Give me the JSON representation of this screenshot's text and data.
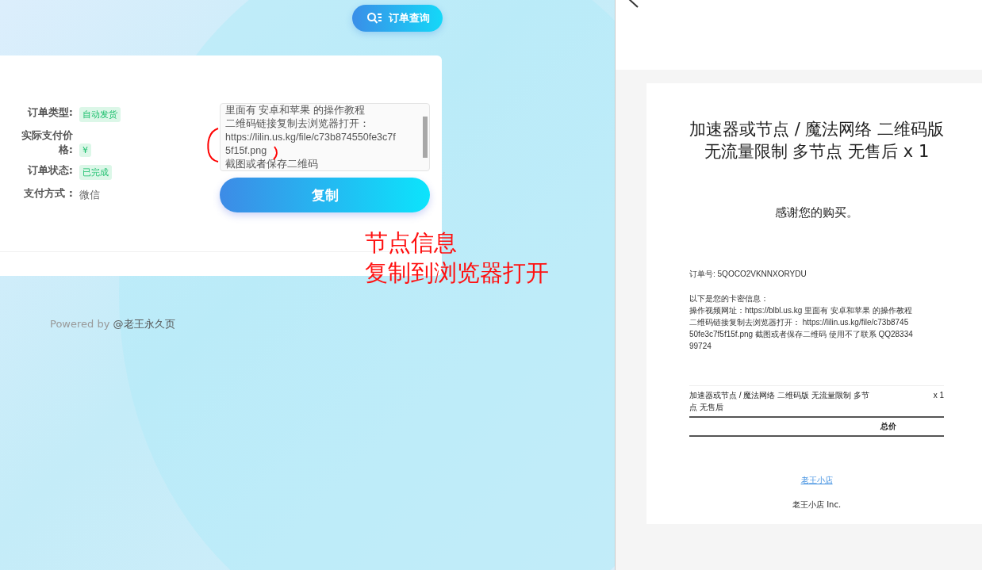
{
  "query_button": {
    "label": "订单查询"
  },
  "order": {
    "fields": [
      {
        "label": "订单类型:",
        "value": "自动发货",
        "kind": "tag"
      },
      {
        "label": "实际支付价格:",
        "value": "¥",
        "kind": "tag"
      },
      {
        "label": "订单状态:",
        "value": "已完成",
        "kind": "tag"
      },
      {
        "label": "支付方式 :",
        "value": "微信",
        "kind": "plain"
      }
    ],
    "card_text": [
      "里面有 安卓和苹果 的操作教程",
      "二维码链接复制去浏览器打开：",
      "https://lilin.us.kg/file/c73b874550fe3c7f",
      "5f15f.png",
      "截图或者保存二维码"
    ],
    "copy_button": "复制"
  },
  "annotation": [
    "节点信息",
    "复制到浏览器打开"
  ],
  "footer": {
    "prefix": "Powered by",
    "name": "@老王永久页"
  },
  "receipt": {
    "title": [
      "加速器或节点 / 魔法网络 二维码版",
      "无流量限制 多节点 无售后 x 1"
    ],
    "thanks": "感谢您的购买。",
    "order_no": "订单号: 5QOCO2VKNNXORYDU",
    "info_heading": "以下是您的卡密信息：",
    "info_body": [
      "操作视频网址：https://blbl.us.kg 里面有 安卓和苹果 的操作教程",
      "二维码链接复制去浏览器打开： https://lilin.us.kg/file/c73b8745",
      "50fe3c7f5f15f.png 截图或者保存二维码 使用不了联系 QQ28334",
      "99724"
    ],
    "items": [
      {
        "name": [
          "加速器或节点 / 魔法网络 二维码版 无流量限制 多节",
          "点 无售后"
        ],
        "qty": "x 1"
      }
    ],
    "total_label": "总价",
    "shop_link": "老王小店",
    "company": "老王小店 Inc."
  }
}
